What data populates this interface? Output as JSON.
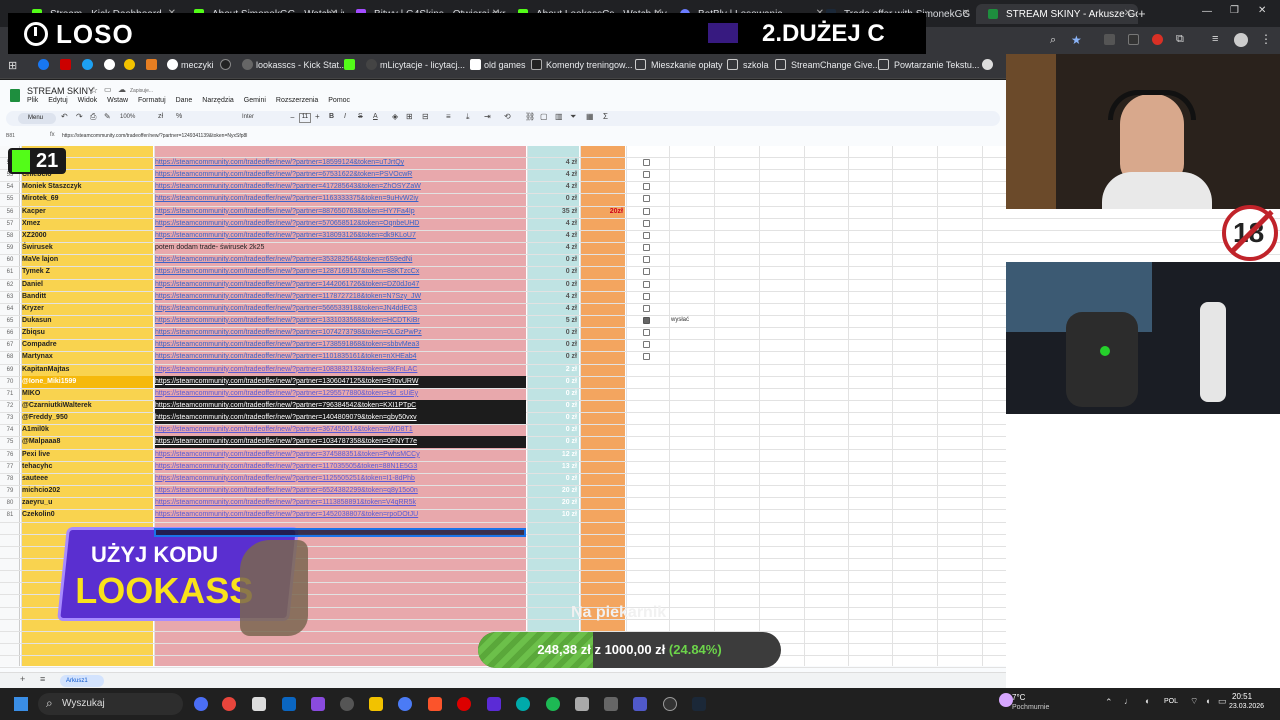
{
  "browser": {
    "tabs": [
      {
        "label": "Stream - Kick Dashboard"
      },
      {
        "label": "About SimonekGG - Watch Liv"
      },
      {
        "label": "Bitwy | G4Skins - Otwieraj skrz"
      },
      {
        "label": "About LookassCs - Watch Liv"
      },
      {
        "label": "BotBlv | Losowania"
      },
      {
        "label": "Trade offer with SimonekGG"
      },
      {
        "label": "STREAM SKINY - Arkusze Goog"
      }
    ],
    "bookmarks": [
      "meczyki",
      "lookasscs - Kick Stat...",
      "mLicytacje - licytacj...",
      "old games",
      "Komendy treningow...",
      "Mieszkanie opłaty",
      "szkola",
      "StreamChange Give...",
      "Powtarzanie Tekstu..."
    ]
  },
  "overlay": {
    "channel_name": "LOSO",
    "ticker": "2.DUŻEJ C",
    "badge_count": "21",
    "age_badge": "18",
    "promo_line1": "UŻYJ KODU",
    "promo_line2": "LOOKASS",
    "goal_title": "Na piekarnik",
    "goal_current": "248,38 zł",
    "goal_sep": "z",
    "goal_target": "1000,00 zł",
    "goal_percent": "(24.84%)",
    "goal_progress": 0.2484
  },
  "sheet": {
    "title": "STREAM SKINY",
    "saving": "Zapisuje...",
    "menu": [
      "Plik",
      "Edytuj",
      "Widok",
      "Wstaw",
      "Formatuj",
      "Dane",
      "Narzędzia",
      "Gemini",
      "Rozszerzenia",
      "Pomoc"
    ],
    "cell_ref": "B81",
    "formula": "https://steamcommunity.com/tradeoffer/new/?partner=1249341139&token=NyxSfp8l",
    "zoom": "100%",
    "font": "Inter",
    "font_size": "11",
    "search_menu": "Menu",
    "columns": [
      "A",
      "B",
      "C",
      "D",
      "E",
      "F",
      "G",
      "H",
      "I",
      "J",
      "K",
      "L"
    ],
    "sheet_tab": "Arkusz1",
    "note": "wysłać",
    "rows": [
      {
        "n": "52",
        "name": "Jesper",
        "link": "https://steamcommunity.com/tradeoffer/new/?partner=18599124&token=uTJrtQy",
        "amt": "4 zł",
        "d": "",
        "cb": false
      },
      {
        "n": "53",
        "name": "Chlebcio",
        "link": "https://steamcommunity.com/tradeoffer/new/?partner=67531622&token=PSVOcwR",
        "amt": "4 zł",
        "d": "",
        "cb": false
      },
      {
        "n": "54",
        "name": "Moniek Staszczyk",
        "link": "https://steamcommunity.com/tradeoffer/new/?partner=417285643&token=ZhOSYZaW",
        "amt": "4 zł",
        "d": "",
        "cb": false
      },
      {
        "n": "55",
        "name": "Mirotek_69",
        "link": "https://steamcommunity.com/tradeoffer/new/?partner=1163333375&token=9uHvW2iy",
        "amt": "0 zł",
        "d": "",
        "cb": false
      },
      {
        "n": "56",
        "name": "Kacper",
        "link": "https://steamcommunity.com/tradeoffer/new/?partner=887650763&token=HY7Fa4Ip",
        "amt": "35 zł",
        "d": "20zł",
        "cb": false
      },
      {
        "n": "57",
        "name": "Xmez",
        "link": "https://steamcommunity.com/tradeoffer/new/?partner=570658512&token=OqnbeUHD",
        "amt": "4 zł",
        "d": "",
        "cb": false
      },
      {
        "n": "58",
        "name": "XZ2000",
        "link": "https://steamcommunity.com/tradeoffer/new/?partner=318093126&token=dk9KLoU7",
        "amt": "4 zł",
        "d": "",
        "cb": false
      },
      {
        "n": "59",
        "name": "Świrusek",
        "link": "potem dodam trade- świrusek 2k25",
        "amt": "4 zł",
        "d": "",
        "cb": false
      },
      {
        "n": "60",
        "name": "MaVe lajon",
        "link": "https://steamcommunity.com/tradeoffer/new/?partner=353282564&token=r6S9edNi",
        "amt": "0 zł",
        "d": "",
        "cb": false
      },
      {
        "n": "61",
        "name": "Tymek Z",
        "link": "https://steamcommunity.com/tradeoffer/new/?partner=1287169157&token=88KTzcCx",
        "amt": "0 zł",
        "d": "",
        "cb": false
      },
      {
        "n": "62",
        "name": "Daniel",
        "link": "https://steamcommunity.com/tradeoffer/new/?partner=1442061726&token=DZ0dJo47",
        "amt": "0 zł",
        "d": "",
        "cb": false
      },
      {
        "n": "63",
        "name": "Banditt",
        "link": "https://steamcommunity.com/tradeoffer/new/?partner=1178727218&token=N7Szy_JW",
        "amt": "4 zł",
        "d": "",
        "cb": false
      },
      {
        "n": "64",
        "name": "Kryzer",
        "link": "https://steamcommunity.com/tradeoffer/new/?partner=566533918&token=JN4ddEC3",
        "amt": "4 zł",
        "d": "",
        "cb": false
      },
      {
        "n": "65",
        "name": "Dukasun",
        "link": "https://steamcommunity.com/tradeoffer/new/?partner=1331033568&token=HCDTKiBr",
        "amt": "5 zł",
        "d": "",
        "cb": true
      },
      {
        "n": "66",
        "name": "Zbiqsu",
        "link": "https://steamcommunity.com/tradeoffer/new/?partner=1074273798&token=0LGzPwPz",
        "amt": "0 zł",
        "d": "",
        "cb": false
      },
      {
        "n": "67",
        "name": "Compadre",
        "link": "https://steamcommunity.com/tradeoffer/new/?partner=1738591868&token=sbbvMea3",
        "amt": "0 zł",
        "d": "",
        "cb": false
      },
      {
        "n": "68",
        "name": "Martynax",
        "link": "https://steamcommunity.com/tradeoffer/new/?partner=1101835161&token=nXHEab4",
        "amt": "0 zł",
        "d": "",
        "cb": false
      }
    ],
    "rows_after": [
      {
        "n": "69",
        "name": "KapitanMajtas",
        "link": "https://steamcommunity.com/tradeoffer/new/?partner=1083832132&token=8KFnLAC",
        "amt": "2 zł",
        "style": "pink"
      },
      {
        "n": "70",
        "name": "@Ione_Miki1599",
        "link": "https://steamcommunity.com/tradeoffer/new/?partner=1306047125&token=9TovURW",
        "amt": "0 zł",
        "style": "dark"
      },
      {
        "n": "71",
        "name": "MIKO",
        "link": "https://steamcommunity.com/tradeoffer/new/?partner=1295577880&token=Hd_sUiEy",
        "amt": "0 zł",
        "style": "pink"
      },
      {
        "n": "72",
        "name": "@CzarniutkiWalterek",
        "link": "https://steamcommunity.com/tradeoffer/new/?partner=796384542&token=KXI1PTpC",
        "amt": "0 zł",
        "style": "dark"
      },
      {
        "n": "73",
        "name": "@Freddy_950",
        "link": "https://steamcommunity.com/tradeoffer/new/?partner=1404809079&token=gby50vxv",
        "amt": "0 zł",
        "style": "dark"
      },
      {
        "n": "74",
        "name": "A1mil0k",
        "link": "https://steamcommunity.com/tradeoffer/new/?partner=367450014&token=mWD8T1",
        "amt": "0 zł",
        "style": "pink"
      },
      {
        "n": "75",
        "name": "@Malpaaa8",
        "link": "https://steamcommunity.com/tradeoffer/new/?partner=1034787358&token=0FNYT7e",
        "amt": "0 zł",
        "style": "dark"
      },
      {
        "n": "76",
        "name": "Pexi live",
        "link": "https://steamcommunity.com/tradeoffer/new/?partner=374588351&token=PwhsMCCy",
        "amt": "12 zł",
        "style": "pink"
      },
      {
        "n": "77",
        "name": "tehacyhc",
        "link": "https://steamcommunity.com/tradeoffer/new/?partner=117035505&token=88N1E5G3",
        "amt": "13 zł",
        "style": "pink"
      },
      {
        "n": "78",
        "name": "sauteee",
        "link": "https://steamcommunity.com/tradeoffer/new/?partner=1125505251&token=I1-8dPhb",
        "amt": "0 zł",
        "style": "pink"
      },
      {
        "n": "79",
        "name": "michcio202",
        "link": "https://steamcommunity.com/tradeoffer/new/?partner=6524382299&token=q8y15o0n",
        "amt": "20 zł",
        "style": "pink"
      },
      {
        "n": "80",
        "name": "zaeyru_u",
        "link": "https://steamcommunity.com/tradeoffer/new/?partner=1113858891&token=V4qRR5k",
        "amt": "20 zł",
        "style": "pink"
      },
      {
        "n": "81",
        "name": "Czekolin0",
        "link": "https://steamcommunity.com/tradeoffer/new/?partner=1452038807&token=rpoDOtJU",
        "amt": "10 zł",
        "style": "pink"
      }
    ]
  },
  "taskbar": {
    "search": "Wyszukaj",
    "weather_temp": "7°C",
    "weather_desc": "Pochmurnie",
    "lang": "POL",
    "time": "20:51",
    "date": "23.03.2026"
  }
}
